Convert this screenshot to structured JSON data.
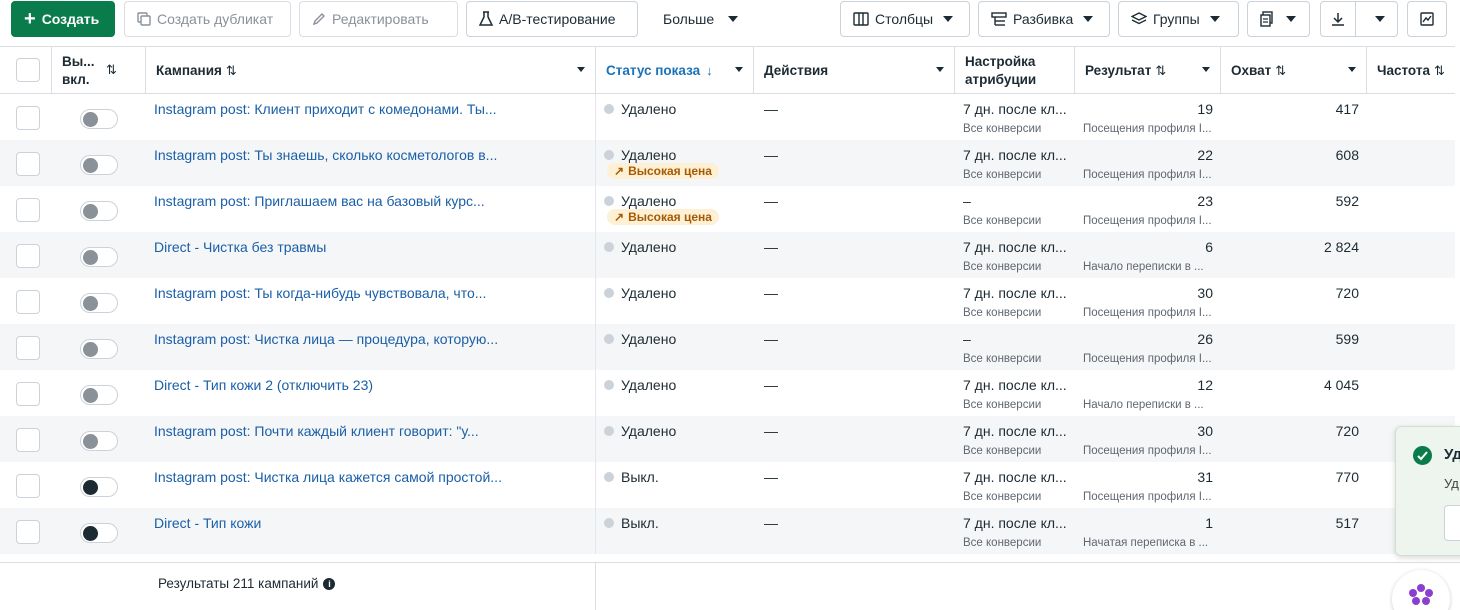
{
  "toolbar": {
    "create": "Создать",
    "duplicate": "Создать дубликат",
    "edit": "Редактировать",
    "ab_test": "A/B-тестирование",
    "more": "Больше",
    "columns": "Столбцы",
    "breakdown": "Разбивка",
    "groups": "Группы"
  },
  "columns": {
    "onoff": "Вы... вкл.",
    "campaign": "Кампания",
    "status": "Статус показа",
    "actions": "Действия",
    "attribution": "Настройка атрибуции",
    "result": "Результат",
    "reach": "Охват",
    "frequency": "Частота"
  },
  "rows": [
    {
      "campaign": "Instagram post: Клиент приходит с комедонами. Ты...",
      "status": "Удалено",
      "badge": "",
      "actions": "—",
      "attr": "7 дн. после кл...",
      "attr_sub": "Все конверсии",
      "result": "19",
      "result_sub": "Посещения профиля I...",
      "reach": "417",
      "toggle": "deleted"
    },
    {
      "campaign": "Instagram post: Ты знаешь, сколько косметологов в...",
      "status": "Удалено",
      "badge": "Высокая цена",
      "actions": "—",
      "attr": "7 дн. после кл...",
      "attr_sub": "Все конверсии",
      "result": "22",
      "result_sub": "Посещения профиля I...",
      "reach": "608",
      "toggle": "deleted"
    },
    {
      "campaign": "Instagram post: Приглашаем вас на базовый курс...",
      "status": "Удалено",
      "badge": "Высокая цена",
      "actions": "—",
      "attr": "–",
      "attr_sub": "Все конверсии",
      "result": "23",
      "result_sub": "Посещения профиля I...",
      "reach": "592",
      "toggle": "deleted"
    },
    {
      "campaign": "Direct - Чистка без травмы",
      "status": "Удалено",
      "badge": "",
      "actions": "—",
      "attr": "7 дн. после кл...",
      "attr_sub": "Все конверсии",
      "result": "6",
      "result_sub": "Начало переписки в ...",
      "reach": "2 824",
      "toggle": "deleted"
    },
    {
      "campaign": "Instagram post: Ты когда-нибудь чувствовала, что...",
      "status": "Удалено",
      "badge": "",
      "actions": "—",
      "attr": "7 дн. после кл...",
      "attr_sub": "Все конверсии",
      "result": "30",
      "result_sub": "Посещения профиля I...",
      "reach": "720",
      "toggle": "deleted"
    },
    {
      "campaign": "Instagram post: Чистка лица — процедура, которую...",
      "status": "Удалено",
      "badge": "",
      "actions": "—",
      "attr": "–",
      "attr_sub": "Все конверсии",
      "result": "26",
      "result_sub": "Посещения профиля I...",
      "reach": "599",
      "toggle": "deleted"
    },
    {
      "campaign": "Direct - Тип кожи 2 (отключить 23)",
      "status": "Удалено",
      "badge": "",
      "actions": "—",
      "attr": "7 дн. после кл...",
      "attr_sub": "Все конверсии",
      "result": "12",
      "result_sub": "Начало переписки в ...",
      "reach": "4 045",
      "toggle": "deleted"
    },
    {
      "campaign": "Instagram post: Почти каждый клиент говорит: \"у...",
      "status": "Удалено",
      "badge": "",
      "actions": "—",
      "attr": "7 дн. после кл...",
      "attr_sub": "Все конверсии",
      "result": "30",
      "result_sub": "Посещения профиля I...",
      "reach": "720",
      "toggle": "deleted"
    },
    {
      "campaign": "Instagram post: Чистка лица кажется самой простой...",
      "status": "Выкл.",
      "badge": "",
      "actions": "—",
      "attr": "7 дн. после кл...",
      "attr_sub": "Все конверсии",
      "result": "31",
      "result_sub": "Посещения профиля I...",
      "reach": "770",
      "toggle": "off"
    },
    {
      "campaign": "Direct - Тип кожи",
      "status": "Выкл.",
      "badge": "",
      "actions": "—",
      "attr": "7 дн. после кл...",
      "attr_sub": "Все конверсии",
      "result": "1",
      "result_sub": "Начатая переписка в ...",
      "reach": "517",
      "toggle": "off"
    }
  ],
  "footer": {
    "summary": "Результаты 211 кампаний"
  },
  "toast": {
    "title": "Уд",
    "text": "Уд"
  },
  "colors": {
    "primary": "#0a7b4b",
    "link": "#1a5fa8",
    "active_header": "#1a73b8",
    "badge_bg": "#fdf0d5",
    "badge_text": "#a75a00"
  }
}
